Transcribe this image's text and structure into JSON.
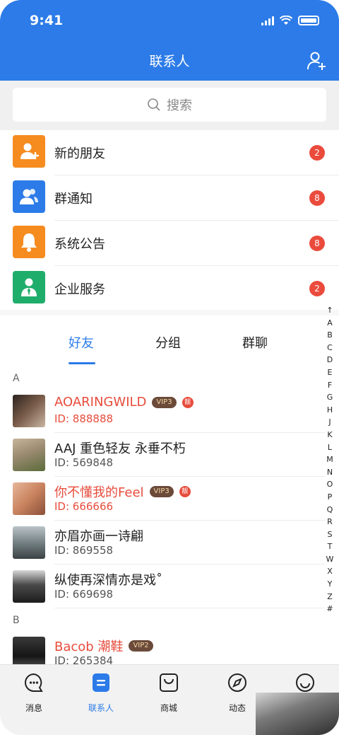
{
  "status_bar": {
    "time": "9:41"
  },
  "header": {
    "title": "联系人"
  },
  "search": {
    "placeholder": "搜索"
  },
  "menu": [
    {
      "label": "新的朋友",
      "badge": "2",
      "color": "#f68b1f",
      "icon": "add-friend-icon"
    },
    {
      "label": "群通知",
      "badge": "8",
      "color": "#2c7be8",
      "icon": "group-icon"
    },
    {
      "label": "系统公告",
      "badge": "8",
      "color": "#f68b1f",
      "icon": "bell-icon"
    },
    {
      "label": "企业服务",
      "badge": "2",
      "color": "#1fad6b",
      "icon": "business-person-icon"
    }
  ],
  "tabs": [
    {
      "label": "好友",
      "active": true
    },
    {
      "label": "分组",
      "active": false
    },
    {
      "label": "群聊",
      "active": false
    }
  ],
  "alphabet": [
    "↑",
    "A",
    "B",
    "C",
    "D",
    "E",
    "F",
    "G",
    "H",
    "J",
    "K",
    "L",
    "M",
    "N",
    "O",
    "P",
    "Q",
    "R",
    "S",
    "T",
    "W",
    "X",
    "Y",
    "Z",
    "#"
  ],
  "sections": [
    {
      "letter": "A",
      "contacts": [
        {
          "name": "AOARINGWILD",
          "id": "ID: 888888",
          "vip": "VIP3",
          "crown": "靓",
          "highlight": true
        },
        {
          "name": "AAJ 重色轻友 永垂不朽",
          "id": "ID: 569848",
          "vip": "",
          "crown": "",
          "highlight": false
        },
        {
          "name": "你不懂我的Feel",
          "id": "ID: 666666",
          "vip": "VIP3",
          "crown": "靓",
          "highlight": true
        },
        {
          "name": "亦眉亦画一诗翩",
          "id": "ID: 869558",
          "vip": "",
          "crown": "",
          "highlight": false
        },
        {
          "name": "纵使再深情亦是戏˚",
          "id": "ID: 669698",
          "vip": "",
          "crown": "",
          "highlight": false
        }
      ]
    },
    {
      "letter": "B",
      "contacts": [
        {
          "name": "Bacob 潮鞋",
          "id": "ID: 265384",
          "vip": "VIP2",
          "crown": "",
          "highlight": true
        }
      ]
    }
  ],
  "tabbar": [
    {
      "label": "消息",
      "icon": "chat-bubble-icon",
      "active": false
    },
    {
      "label": "联系人",
      "icon": "contacts-icon",
      "active": true
    },
    {
      "label": "商城",
      "icon": "shopping-bag-icon",
      "active": false
    },
    {
      "label": "动态",
      "icon": "compass-icon",
      "active": false
    },
    {
      "label": "",
      "icon": "smiley-icon",
      "active": false
    }
  ],
  "colors": {
    "primary": "#2c7be8",
    "badge": "#ea4b3c",
    "vip_name": "#e74c3c"
  }
}
